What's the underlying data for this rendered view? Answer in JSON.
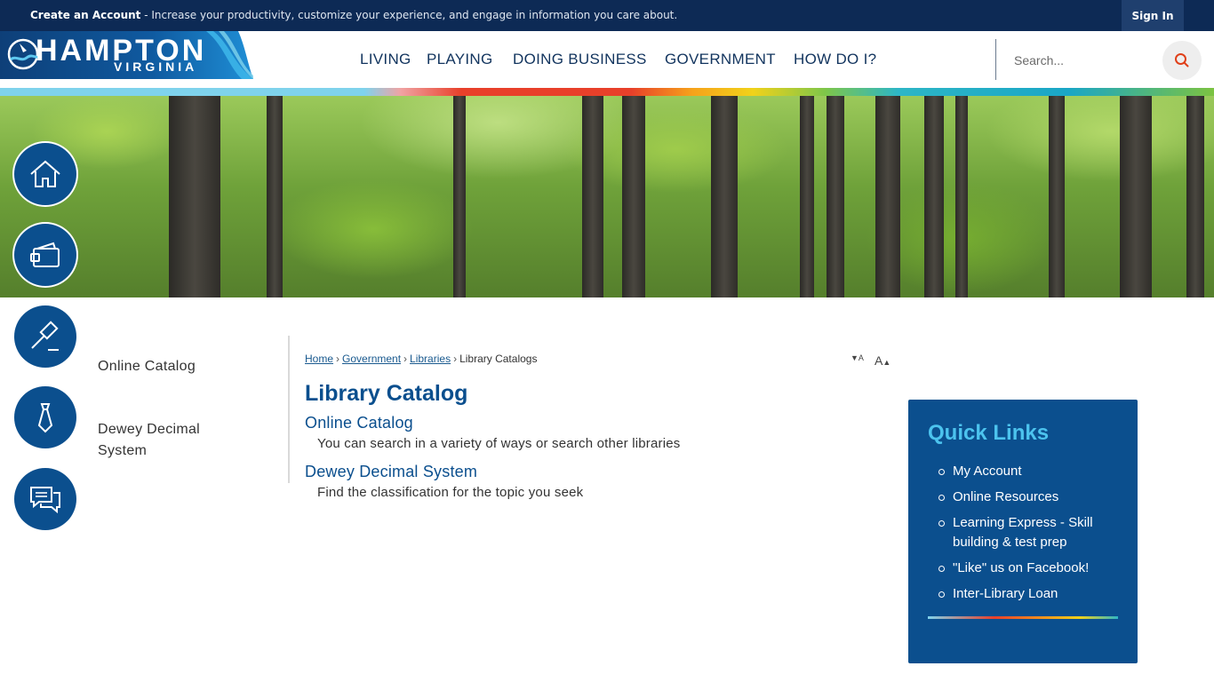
{
  "topbar": {
    "account_label": "Create an Account",
    "message": " - Increase your productivity, customize your experience, and engage in information you care about.",
    "signin_label": "Sign In"
  },
  "header": {
    "logo_main": "HAMPTON",
    "logo_sub": "VIRGINIA",
    "nav": [
      "LIVING",
      "PLAYING",
      "DOING BUSINESS",
      "GOVERNMENT",
      "HOW DO I?"
    ],
    "search_placeholder": "Search..."
  },
  "colors": {
    "brand_navy": "#0d2a55",
    "brand_blue": "#0b4f8e",
    "accent_cyan": "#4cc3ee",
    "search_red": "#e0401a"
  },
  "circle_nav": [
    "home-icon",
    "wallet-icon",
    "gavel-icon",
    "necktie-icon",
    "chat-icon"
  ],
  "sidenav": [
    "Online Catalog",
    "Dewey Decimal System"
  ],
  "breadcrumb": {
    "items": [
      "Home",
      "Government",
      "Libraries"
    ],
    "current": "Library Catalogs",
    "separator": "›"
  },
  "resize": {
    "decrease": "A",
    "increase": "A"
  },
  "main": {
    "title": "Library Catalog",
    "entries": [
      {
        "title": "Online Catalog",
        "desc": "You can search in a variety of ways or search other libraries"
      },
      {
        "title": "Dewey Decimal System",
        "desc": "Find the classification for the topic you seek"
      }
    ]
  },
  "quicklinks": {
    "title": "Quick Links",
    "items": [
      "My Account",
      "Online Resources",
      "Learning Express - Skill building & test prep",
      "\"Like\" us on Facebook!",
      "Inter-Library Loan"
    ]
  }
}
